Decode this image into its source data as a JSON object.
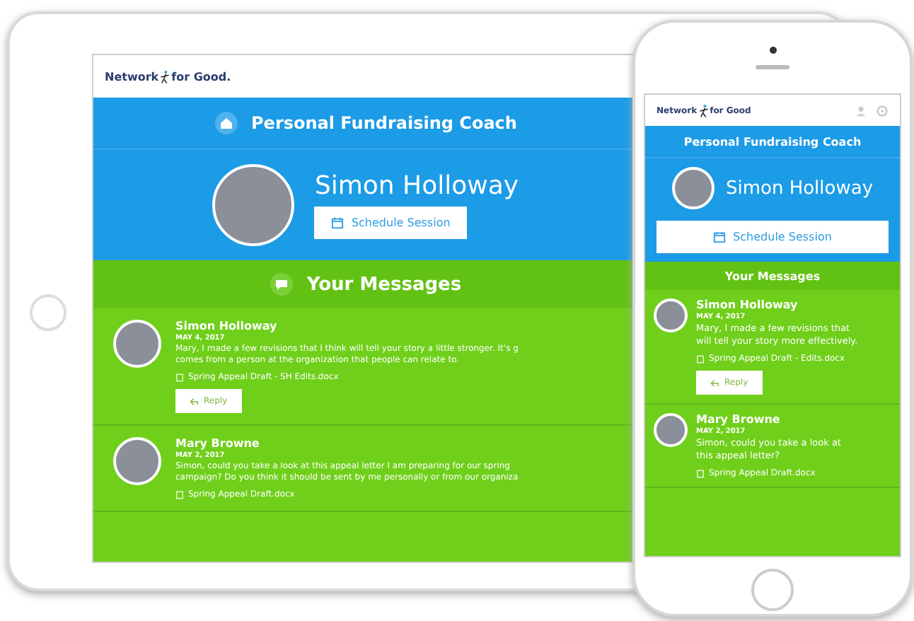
{
  "devices": [
    {
      "kind": "tablet",
      "logo": [
        "Network",
        "for Good."
      ],
      "title": "Personal Fundraising Coach",
      "coach_name": "Simon Holloway",
      "schedule_button": "Schedule Session",
      "section_title": "Your Messages",
      "messages": [
        {
          "author": "Simon Holloway",
          "date": "MAY 4, 2017",
          "body_lines": [
            "Mary, I made a few revisions that I think will tell your story a little stronger. It's g",
            "comes from a person at the organization that people can relate to."
          ],
          "attachment": "Spring Appeal Draft - SH Edits.docx",
          "reply_button": "Reply"
        },
        {
          "author": "Mary Browne",
          "date": "MAY 2, 2017",
          "body_lines": [
            "Simon, could you take a look at this appeal letter I am preparing for our spring",
            "campaign? Do you think it should be sent by me personally or from our organiza"
          ],
          "attachment": "Spring Appeal Draft.docx"
        }
      ]
    },
    {
      "kind": "phone",
      "logo": [
        "Network",
        "for Good"
      ],
      "title": "Personal Fundraising Coach",
      "coach_name": "Simon Holloway",
      "schedule_button": "Schedule Session",
      "section_title": "Your Messages",
      "messages": [
        {
          "author": "Simon Holloway",
          "date": "MAY 4, 2017",
          "body_lines": [
            "Mary, I made a few revisions that",
            "will tell your story more effectively."
          ],
          "attachment": "Spring Appeal Draft - Edits.docx",
          "reply_button": "Reply"
        },
        {
          "author": "Mary Browne",
          "date": "MAY 2, 2017",
          "body_lines": [
            "Simon, could you take a look at",
            "this appeal letter?"
          ],
          "attachment": "Spring Appeal Draft.docx"
        }
      ]
    }
  ]
}
